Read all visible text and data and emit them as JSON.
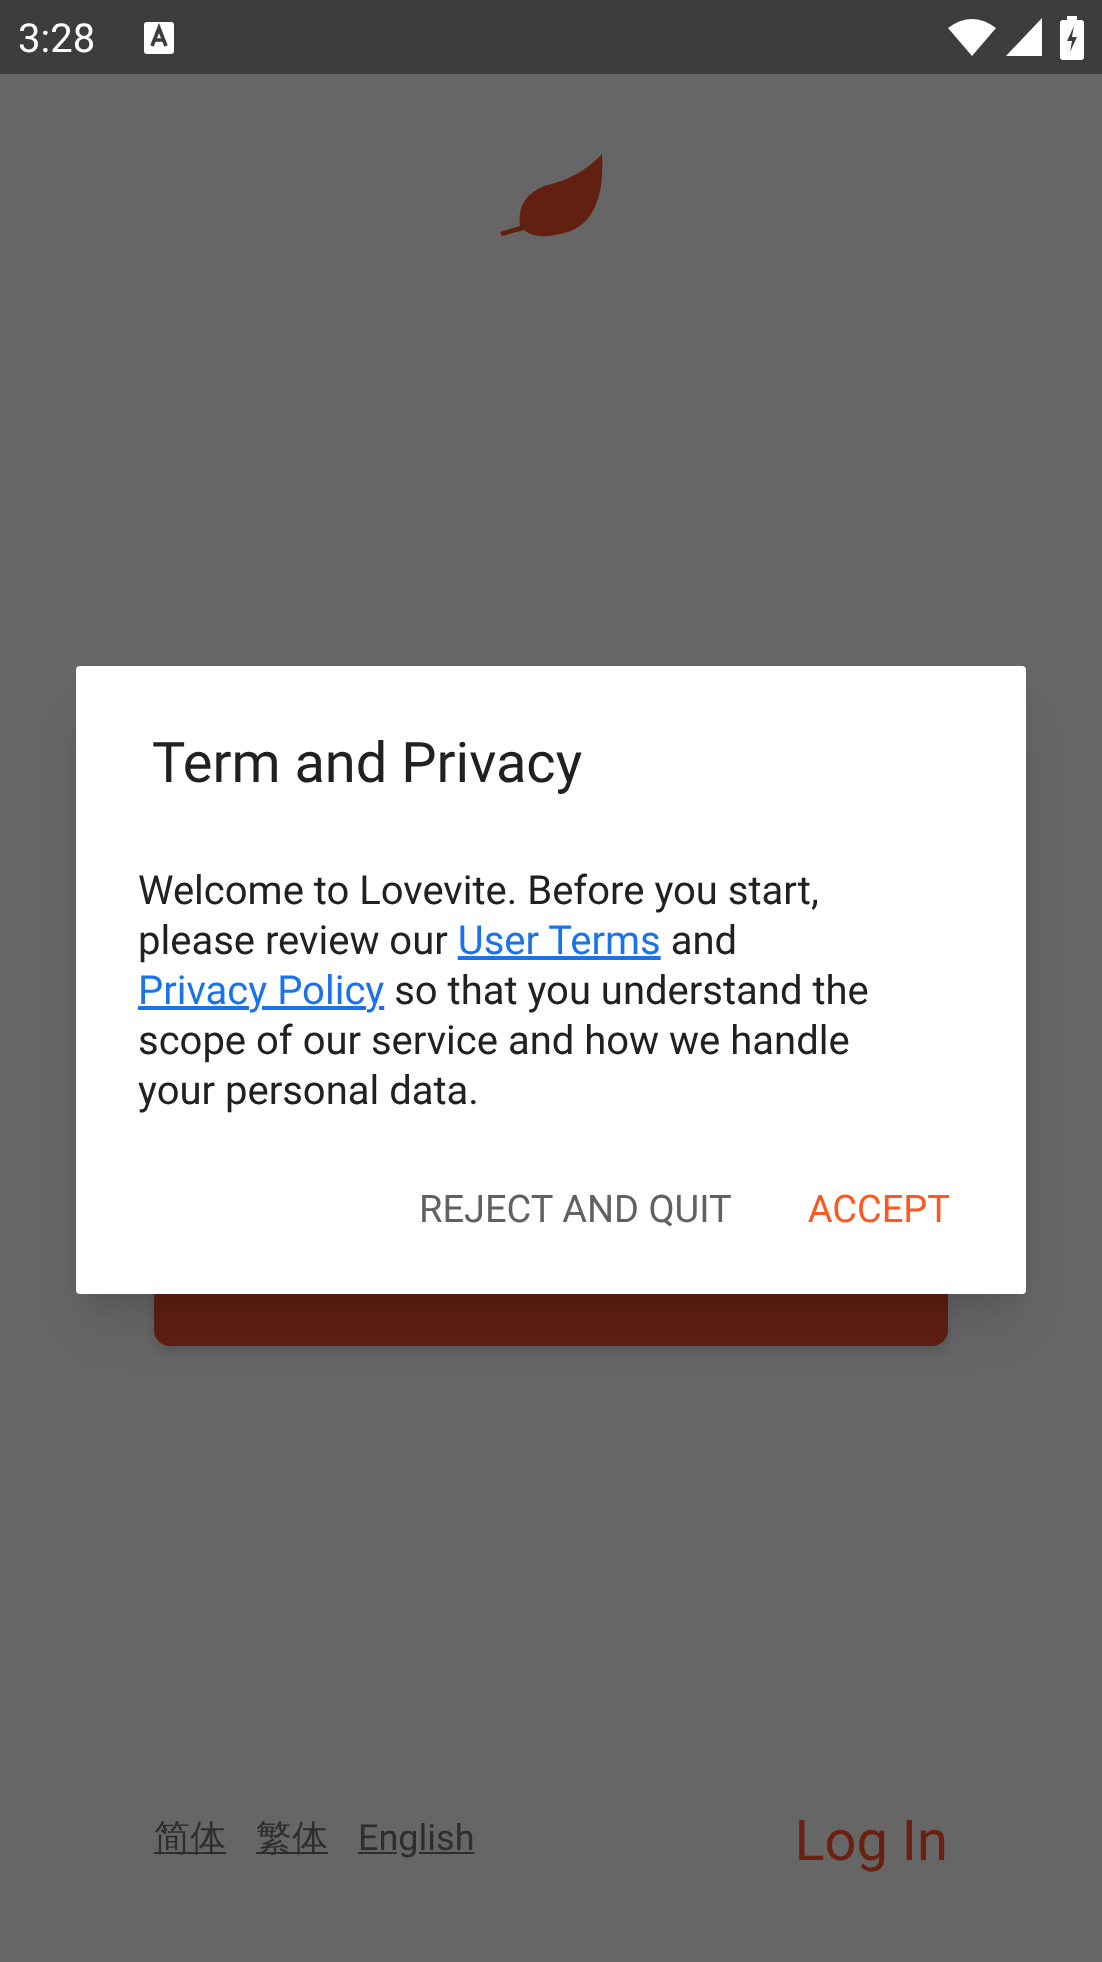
{
  "status_bar": {
    "time": "3:28"
  },
  "languages": [
    {
      "label": "简体"
    },
    {
      "label": "繁体"
    },
    {
      "label": "English"
    }
  ],
  "login": {
    "label": "Log In"
  },
  "dialog": {
    "title": "Term and Privacy",
    "body": [
      {
        "kind": "text",
        "text": "Welcome to Lovevite. Before you start, please review our"
      },
      {
        "kind": "link",
        "text": "User Terms"
      },
      {
        "kind": "text",
        "text": "and"
      },
      {
        "kind": "link",
        "text": "Privacy Policy"
      },
      {
        "kind": "text",
        "text": "so that you understand the scope of our service and how we handle your personal data."
      }
    ],
    "buttons": [
      {
        "label": "REJECT AND QUIT",
        "kind": "secondary"
      },
      {
        "label": "ACCEPT",
        "kind": "primary"
      }
    ]
  }
}
